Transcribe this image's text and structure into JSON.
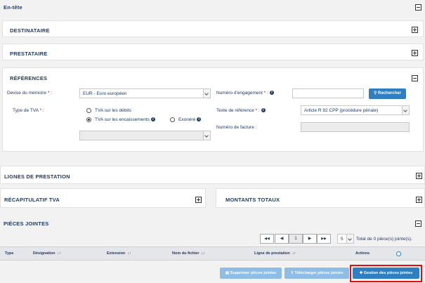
{
  "sections": {
    "entete": "En-tête",
    "destinataire": "Destinataire",
    "prestataire": "Prestataire",
    "references": "Références",
    "lignes": "Lignes de prestation",
    "recap_tva": "Récapitulatif TVA",
    "montants": "Montants totaux",
    "pieces": "Pièces jointes"
  },
  "references": {
    "devise_label": "Devise du mémoire",
    "devise_value": "EUR - Euro européen",
    "type_tva_label": "Type de TVA",
    "tva_options": [
      "TVA sur les débits",
      "TVA sur les encaissements",
      "Exonéré"
    ],
    "tva_selected": 1,
    "engagement_label": "Numéro d'engagement",
    "engagement_value": "",
    "search_button": "Rechercher",
    "texte_ref_label": "Texte de référence",
    "texte_ref_value": "Article R 92 CPP (procédure pénale)",
    "facture_label": "Numéro de facture :",
    "required_mark": "*",
    "colon": ":"
  },
  "pagination": {
    "first": "◀◀",
    "prev": "◀",
    "current": "1",
    "next": "▶",
    "last": "▶▶",
    "page_size": "5",
    "total_text": "Total de 0 pièce(s) jointe(s)."
  },
  "table": {
    "columns": [
      "Type",
      "Désignation",
      "Extension",
      "Nom du fichier",
      "Ligne de prestation",
      "Actions"
    ],
    "rows": []
  },
  "actions": {
    "delete": "Supprimer pièces jointes",
    "download": "Télécharger pièces jointes",
    "manage": "Gestion des pièces jointes"
  },
  "colors": {
    "primary": "#2f7ec2",
    "highlight": "#e01010",
    "text": "#1f3b66"
  }
}
